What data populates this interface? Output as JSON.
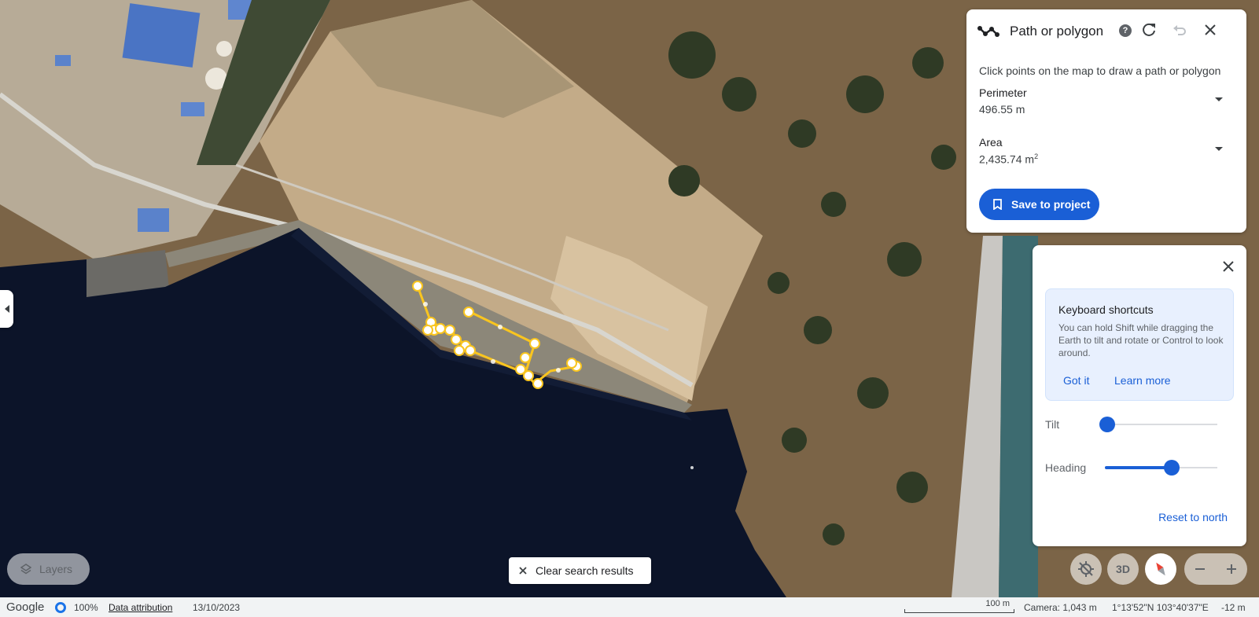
{
  "map": {
    "imagery": "satellite",
    "drawn_path_color": "#f9c51f"
  },
  "measure_panel": {
    "icon": "path-icon",
    "title": "Path or polygon",
    "help_icon": "help-icon",
    "help_glyph": "?",
    "refresh_icon": "refresh-icon",
    "undo_icon": "undo-icon",
    "close_icon": "close-icon",
    "instruction": "Click points on the map to draw a path or polygon",
    "perimeter": {
      "label": "Perimeter",
      "value": "496.55 m"
    },
    "area": {
      "label": "Area",
      "value": "2,435.74 m",
      "unit_sup": "2"
    },
    "save_button": {
      "icon": "bookmark-icon",
      "label": "Save to project"
    },
    "accent_color": "#1a5fd6"
  },
  "nav_panel": {
    "close_icon": "close-icon",
    "shortcuts": {
      "title": "Keyboard shortcuts",
      "body": "You can hold Shift while dragging the Earth to tilt and rotate or Control to look around.",
      "got_it": "Got it",
      "learn_more": "Learn more"
    },
    "tilt": {
      "label": "Tilt",
      "value": 0.0
    },
    "heading": {
      "label": "Heading",
      "value": 0.61
    },
    "reset": "Reset to north"
  },
  "controls": {
    "layers": {
      "icon": "layers-icon",
      "label": "Layers"
    },
    "clear_search": {
      "icon": "close-icon",
      "label": "Clear search results"
    },
    "location_icon": "location-off-icon",
    "mode_3d": "3D",
    "compass_icon": "compass-icon",
    "zoom_out_icon": "minus-icon",
    "zoom_in_icon": "plus-icon"
  },
  "status_bar": {
    "brand": "Google",
    "loading": "100%",
    "data_attribution": "Data attribution",
    "date": "13/10/2023",
    "scale": "100 m",
    "camera": "Camera: 1,043 m",
    "coordinates": "1°13'52\"N 103°40'37\"E",
    "elevation": "-12 m"
  }
}
